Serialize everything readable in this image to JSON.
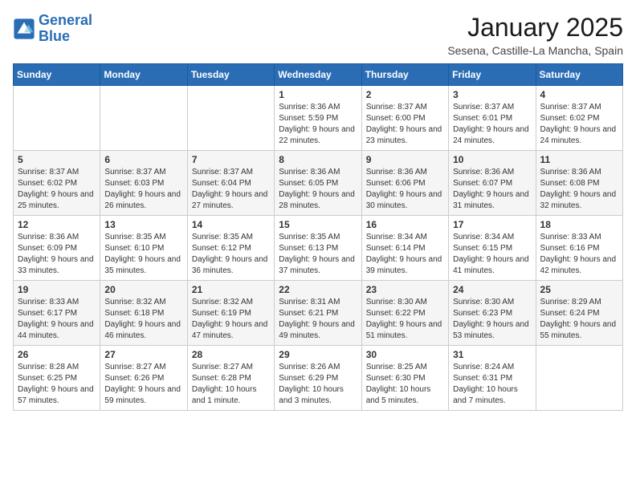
{
  "logo": {
    "line1": "General",
    "line2": "Blue"
  },
  "title": "January 2025",
  "location": "Sesena, Castille-La Mancha, Spain",
  "weekdays": [
    "Sunday",
    "Monday",
    "Tuesday",
    "Wednesday",
    "Thursday",
    "Friday",
    "Saturday"
  ],
  "weeks": [
    [
      null,
      null,
      null,
      {
        "day": 1,
        "sunrise": "8:36 AM",
        "sunset": "5:59 PM",
        "daylight": "9 hours and 22 minutes."
      },
      {
        "day": 2,
        "sunrise": "8:37 AM",
        "sunset": "6:00 PM",
        "daylight": "9 hours and 23 minutes."
      },
      {
        "day": 3,
        "sunrise": "8:37 AM",
        "sunset": "6:01 PM",
        "daylight": "9 hours and 24 minutes."
      },
      {
        "day": 4,
        "sunrise": "8:37 AM",
        "sunset": "6:02 PM",
        "daylight": "9 hours and 24 minutes."
      }
    ],
    [
      {
        "day": 5,
        "sunrise": "8:37 AM",
        "sunset": "6:02 PM",
        "daylight": "9 hours and 25 minutes."
      },
      {
        "day": 6,
        "sunrise": "8:37 AM",
        "sunset": "6:03 PM",
        "daylight": "9 hours and 26 minutes."
      },
      {
        "day": 7,
        "sunrise": "8:37 AM",
        "sunset": "6:04 PM",
        "daylight": "9 hours and 27 minutes."
      },
      {
        "day": 8,
        "sunrise": "8:36 AM",
        "sunset": "6:05 PM",
        "daylight": "9 hours and 28 minutes."
      },
      {
        "day": 9,
        "sunrise": "8:36 AM",
        "sunset": "6:06 PM",
        "daylight": "9 hours and 30 minutes."
      },
      {
        "day": 10,
        "sunrise": "8:36 AM",
        "sunset": "6:07 PM",
        "daylight": "9 hours and 31 minutes."
      },
      {
        "day": 11,
        "sunrise": "8:36 AM",
        "sunset": "6:08 PM",
        "daylight": "9 hours and 32 minutes."
      }
    ],
    [
      {
        "day": 12,
        "sunrise": "8:36 AM",
        "sunset": "6:09 PM",
        "daylight": "9 hours and 33 minutes."
      },
      {
        "day": 13,
        "sunrise": "8:35 AM",
        "sunset": "6:10 PM",
        "daylight": "9 hours and 35 minutes."
      },
      {
        "day": 14,
        "sunrise": "8:35 AM",
        "sunset": "6:12 PM",
        "daylight": "9 hours and 36 minutes."
      },
      {
        "day": 15,
        "sunrise": "8:35 AM",
        "sunset": "6:13 PM",
        "daylight": "9 hours and 37 minutes."
      },
      {
        "day": 16,
        "sunrise": "8:34 AM",
        "sunset": "6:14 PM",
        "daylight": "9 hours and 39 minutes."
      },
      {
        "day": 17,
        "sunrise": "8:34 AM",
        "sunset": "6:15 PM",
        "daylight": "9 hours and 41 minutes."
      },
      {
        "day": 18,
        "sunrise": "8:33 AM",
        "sunset": "6:16 PM",
        "daylight": "9 hours and 42 minutes."
      }
    ],
    [
      {
        "day": 19,
        "sunrise": "8:33 AM",
        "sunset": "6:17 PM",
        "daylight": "9 hours and 44 minutes."
      },
      {
        "day": 20,
        "sunrise": "8:32 AM",
        "sunset": "6:18 PM",
        "daylight": "9 hours and 46 minutes."
      },
      {
        "day": 21,
        "sunrise": "8:32 AM",
        "sunset": "6:19 PM",
        "daylight": "9 hours and 47 minutes."
      },
      {
        "day": 22,
        "sunrise": "8:31 AM",
        "sunset": "6:21 PM",
        "daylight": "9 hours and 49 minutes."
      },
      {
        "day": 23,
        "sunrise": "8:30 AM",
        "sunset": "6:22 PM",
        "daylight": "9 hours and 51 minutes."
      },
      {
        "day": 24,
        "sunrise": "8:30 AM",
        "sunset": "6:23 PM",
        "daylight": "9 hours and 53 minutes."
      },
      {
        "day": 25,
        "sunrise": "8:29 AM",
        "sunset": "6:24 PM",
        "daylight": "9 hours and 55 minutes."
      }
    ],
    [
      {
        "day": 26,
        "sunrise": "8:28 AM",
        "sunset": "6:25 PM",
        "daylight": "9 hours and 57 minutes."
      },
      {
        "day": 27,
        "sunrise": "8:27 AM",
        "sunset": "6:26 PM",
        "daylight": "9 hours and 59 minutes."
      },
      {
        "day": 28,
        "sunrise": "8:27 AM",
        "sunset": "6:28 PM",
        "daylight": "10 hours and 1 minute."
      },
      {
        "day": 29,
        "sunrise": "8:26 AM",
        "sunset": "6:29 PM",
        "daylight": "10 hours and 3 minutes."
      },
      {
        "day": 30,
        "sunrise": "8:25 AM",
        "sunset": "6:30 PM",
        "daylight": "10 hours and 5 minutes."
      },
      {
        "day": 31,
        "sunrise": "8:24 AM",
        "sunset": "6:31 PM",
        "daylight": "10 hours and 7 minutes."
      },
      null
    ]
  ]
}
